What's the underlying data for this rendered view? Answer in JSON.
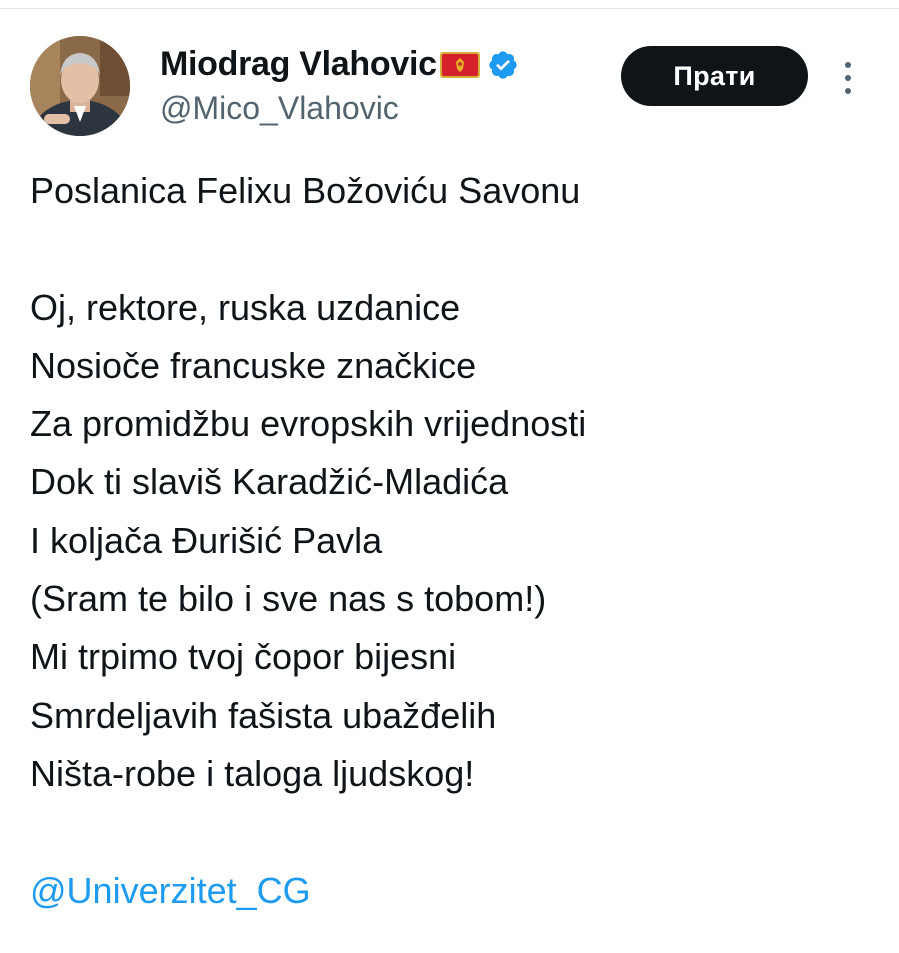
{
  "author": {
    "display_name": "Miodrag Vlahovic",
    "flag_icon": "montenegro-flag-icon",
    "verified_icon": "verified-badge-icon",
    "verified_color": "#1d9bf0",
    "handle": "@Mico_Vlahovic"
  },
  "actions": {
    "follow_label": "Прати",
    "more_icon": "more-vertical-icon"
  },
  "tweet": {
    "title_line": "Poslanica Felixu Božoviću Savonu",
    "poem_lines": [
      "Oj, rektore, ruska uzdanice",
      "Nosioče francuske značkice",
      "Za promidžbu evropskih vrijednosti",
      "Dok ti slaviš Karadžić-Mladića",
      "I koljača Đurišić Pavla",
      "(Sram te bilo i sve nas s tobom!)",
      "Mi trpimo tvoj čopor bijesni",
      "Smrdeljavih fašista ubažđelih",
      "Ništa-robe i taloga ljudskog!"
    ],
    "mention": "@Univerzitet_CG"
  },
  "colors": {
    "text": "#0f1419",
    "secondary_text": "#536471",
    "link": "#1d9bf0",
    "button_bg": "#0f1419",
    "button_text": "#ffffff"
  }
}
